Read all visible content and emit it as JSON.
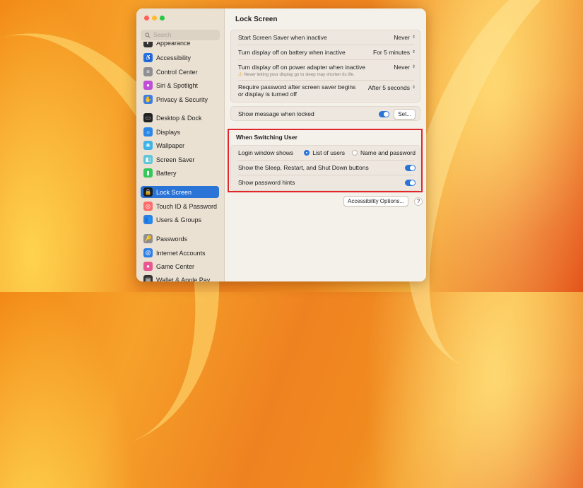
{
  "colors": {
    "accent": "#2a74d7",
    "highlight": "#e0262a",
    "close": "#fe5f57",
    "minimize": "#febc2e",
    "zoom": "#28c840"
  },
  "sidebar": {
    "search_placeholder": "Search",
    "items": [
      {
        "label": "Appearance",
        "icon": "appearance-icon",
        "color": "#333333"
      },
      {
        "label": "Accessibility",
        "icon": "accessibility-icon",
        "color": "#1f6fe0"
      },
      {
        "label": "Control Center",
        "icon": "control-center-icon",
        "color": "#8e8e93"
      },
      {
        "label": "Siri & Spotlight",
        "icon": "siri-icon",
        "color": "#c04fd8"
      },
      {
        "label": "Privacy & Security",
        "icon": "hand-icon",
        "color": "#3a7fe6"
      },
      {
        "label": "Desktop & Dock",
        "icon": "dock-icon",
        "color": "#222222"
      },
      {
        "label": "Displays",
        "icon": "displays-icon",
        "color": "#2b86e8"
      },
      {
        "label": "Wallpaper",
        "icon": "wallpaper-icon",
        "color": "#3fb3e6"
      },
      {
        "label": "Screen Saver",
        "icon": "screen-saver-icon",
        "color": "#5fc6d9"
      },
      {
        "label": "Battery",
        "icon": "battery-icon",
        "color": "#34c759"
      },
      {
        "label": "Lock Screen",
        "icon": "lock-icon",
        "color": "#1c1c1e"
      },
      {
        "label": "Touch ID & Password",
        "icon": "fingerprint-icon",
        "color": "#ff6b6b"
      },
      {
        "label": "Users & Groups",
        "icon": "users-icon",
        "color": "#2f7ee6"
      },
      {
        "label": "Passwords",
        "icon": "key-icon",
        "color": "#8e8e93"
      },
      {
        "label": "Internet Accounts",
        "icon": "at-icon",
        "color": "#2f7ee6"
      },
      {
        "label": "Game Center",
        "icon": "game-center-icon",
        "color": "#e8578f"
      },
      {
        "label": "Wallet & Apple Pay",
        "icon": "wallet-icon",
        "color": "#333333"
      }
    ]
  },
  "main": {
    "title": "Lock Screen",
    "settings": {
      "screensaver_label": "Start Screen Saver when inactive",
      "screensaver_value": "Never",
      "battery_label": "Turn display off on battery when inactive",
      "battery_value": "For 5 minutes",
      "power_label": "Turn display off on power adapter when inactive",
      "power_value": "Never",
      "power_note": "Never letting your display go to sleep may shorten its life.",
      "password_label": "Require password after screen saver begins or display is turned off",
      "password_value": "After 5 seconds",
      "message_label": "Show message when locked",
      "message_button": "Set..."
    },
    "switching": {
      "heading": "When Switching User",
      "login_label": "Login window shows",
      "option_list": "List of users",
      "option_name": "Name and password",
      "selected": "List of users",
      "sleep_label": "Show the Sleep, Restart, and Shut Down buttons",
      "hints_label": "Show password hints"
    },
    "accessibility_button": "Accessibility Options...",
    "help": "?"
  }
}
